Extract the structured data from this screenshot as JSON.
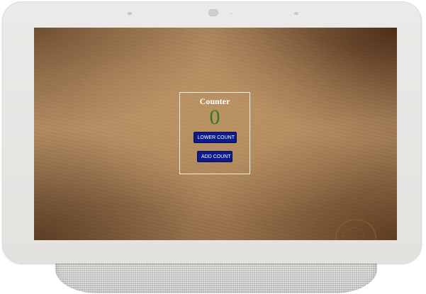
{
  "counter": {
    "title": "Counter",
    "value": "0",
    "lower_button_label": "LOWER COUNT",
    "add_button_label": "ADD COUNT"
  },
  "colors": {
    "value_text": "#2f7d1b",
    "button_bg": "#0d1a8a",
    "title_text": "#ffffff"
  }
}
